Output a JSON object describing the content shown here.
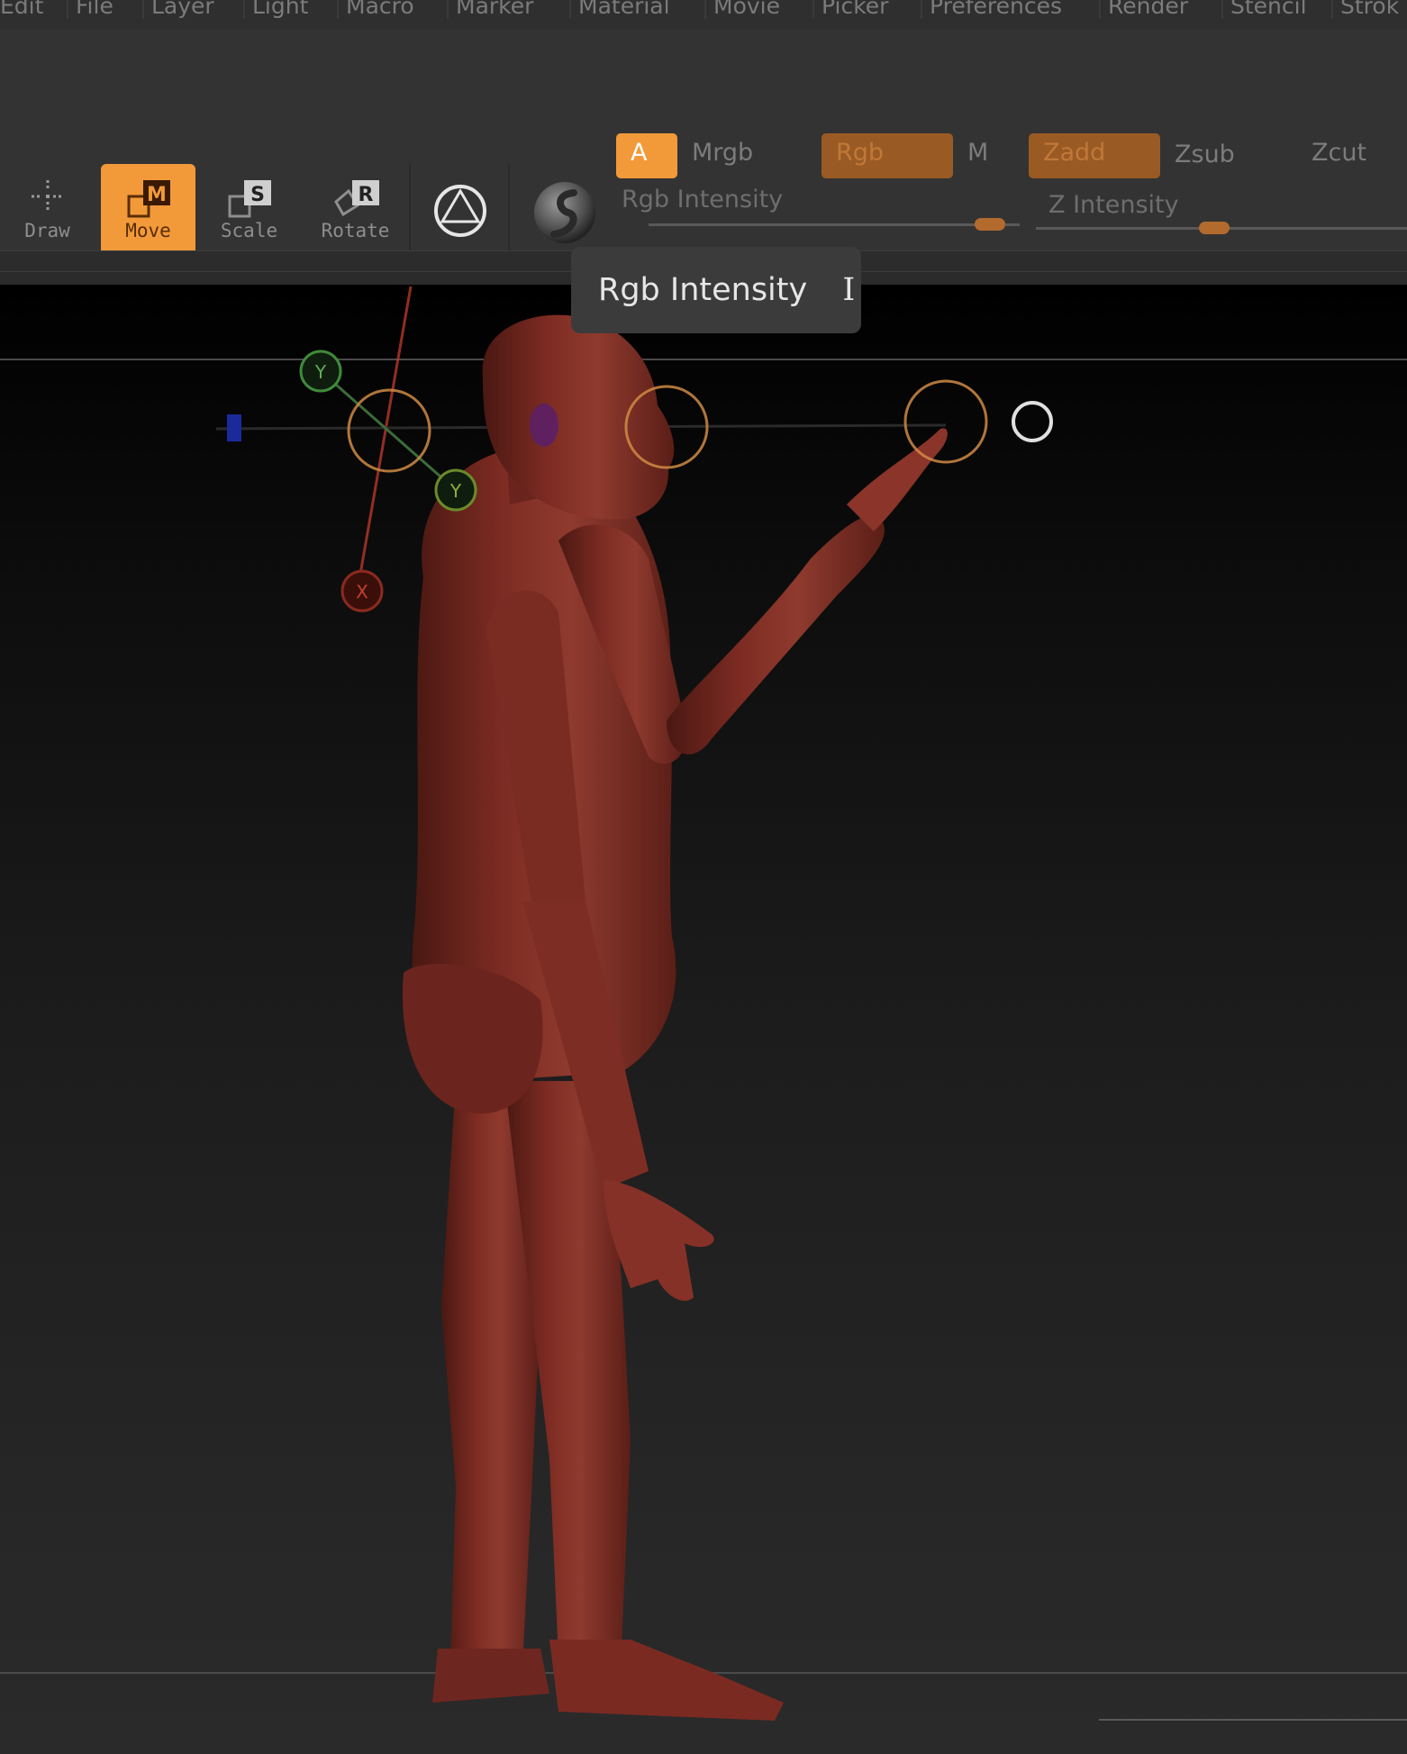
{
  "menu": {
    "items": [
      "Edit",
      "File",
      "Layer",
      "Light",
      "Macro",
      "Marker",
      "Material",
      "Movie",
      "Picker",
      "Preferences",
      "Render",
      "Stencil",
      "Strok"
    ]
  },
  "toolbar": {
    "draw": {
      "label": "Draw"
    },
    "move": {
      "label": "Move",
      "key": "M"
    },
    "scale": {
      "label": "Scale",
      "key": "S"
    },
    "rotate": {
      "label": "Rotate",
      "key": "R"
    },
    "a_label": "A",
    "mrgb_label": "Mrgb",
    "rgb_label": "Rgb",
    "m_label": "M",
    "zadd_label": "Zadd",
    "zsub_label": "Zsub",
    "zcut_label": "Zcut",
    "rgb_intensity_label": "Rgb Intensity",
    "z_intensity_label": "Z Intensity",
    "rgb_intensity_value": 0.92,
    "z_intensity_value": 0.48
  },
  "tooltip": {
    "text": "Rgb Intensity",
    "hotkey": "I"
  },
  "gizmo": {
    "y_label": "Y",
    "x_label": "X"
  },
  "colors": {
    "accent": "#f29a3a",
    "model": "#7a2a22",
    "background": "#000000"
  }
}
